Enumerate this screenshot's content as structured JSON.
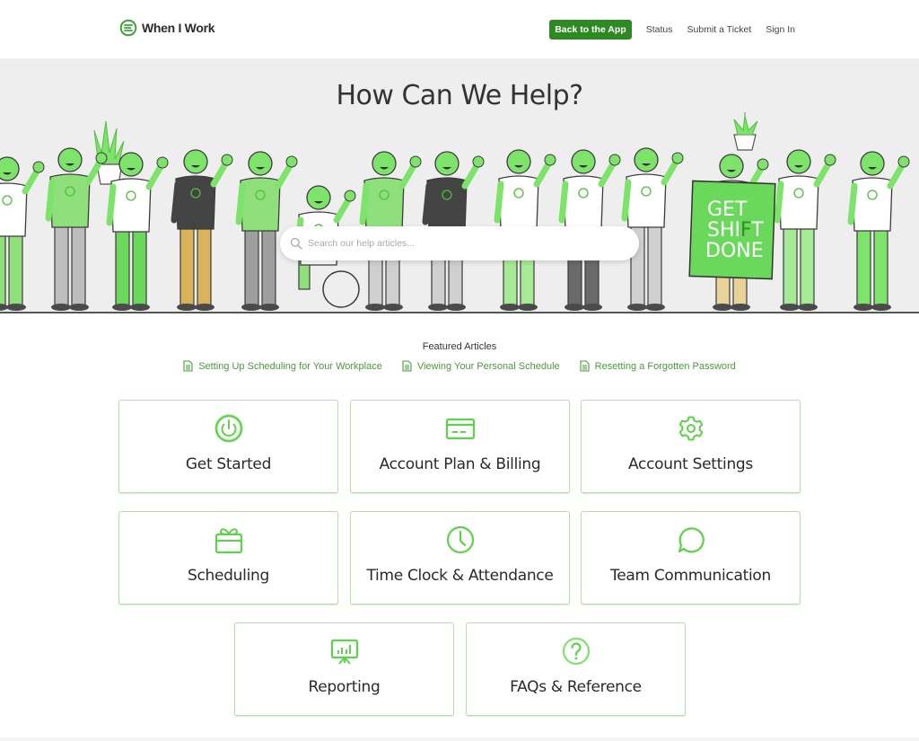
{
  "header": {
    "logo_text": "When I Work",
    "nav": {
      "back_to_app": "Back to the App",
      "status": "Status",
      "submit_ticket": "Submit a Ticket",
      "sign_in": "Sign In"
    }
  },
  "hero": {
    "title": "How Can We Help?",
    "search_placeholder": "Search our help articles...",
    "sign_text": [
      "GET",
      "SHI",
      "F",
      "T",
      "DONE"
    ]
  },
  "featured": {
    "title": "Featured Articles",
    "articles": [
      "Setting Up Scheduling for Your Workplace",
      "Viewing Your Personal Schedule",
      "Resetting a Forgotten Password"
    ]
  },
  "categories": [
    {
      "label": "Get Started",
      "icon": "power-icon"
    },
    {
      "label": "Account Plan & Billing",
      "icon": "credit-card-icon"
    },
    {
      "label": "Account Settings",
      "icon": "gear-icon"
    },
    {
      "label": "Scheduling",
      "icon": "calendar-gift-icon"
    },
    {
      "label": "Time Clock & Attendance",
      "icon": "clock-icon"
    },
    {
      "label": "Team Communication",
      "icon": "chat-bubble-icon"
    },
    {
      "label": "Reporting",
      "icon": "presentation-chart-icon"
    },
    {
      "label": "FAQs & Reference",
      "icon": "question-circle-icon"
    }
  ],
  "colors": {
    "brand_green": "#2d8a23",
    "accent_green": "#5ed24a",
    "link_green": "#4a9a3c",
    "card_border": "#b9dcb0"
  }
}
